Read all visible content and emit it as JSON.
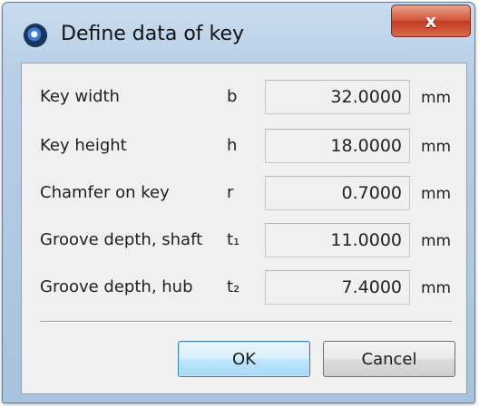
{
  "window": {
    "title": "Define data of key",
    "close_glyph": "x"
  },
  "rows": [
    {
      "label": "Key width",
      "symbol": "b",
      "value": "32.0000",
      "unit": "mm"
    },
    {
      "label": "Key height",
      "symbol": "h",
      "value": "18.0000",
      "unit": "mm"
    },
    {
      "label": "Chamfer on key",
      "symbol": "r",
      "value": "0.7000",
      "unit": "mm"
    },
    {
      "label": "Groove depth, shaft",
      "symbol": "t₁",
      "value": "11.0000",
      "unit": "mm"
    },
    {
      "label": "Groove depth, hub",
      "symbol": "t₂",
      "value": "7.4000",
      "unit": "mm"
    }
  ],
  "buttons": {
    "ok": "OK",
    "cancel": "Cancel"
  },
  "icons": {
    "app": "app-logo-icon",
    "close": "close-icon"
  },
  "colors": {
    "title_bar": "#b7cfe6",
    "close_button": "#d5563c",
    "client_bg": "#f0f0f0",
    "ok_border": "#3c7fb1"
  }
}
